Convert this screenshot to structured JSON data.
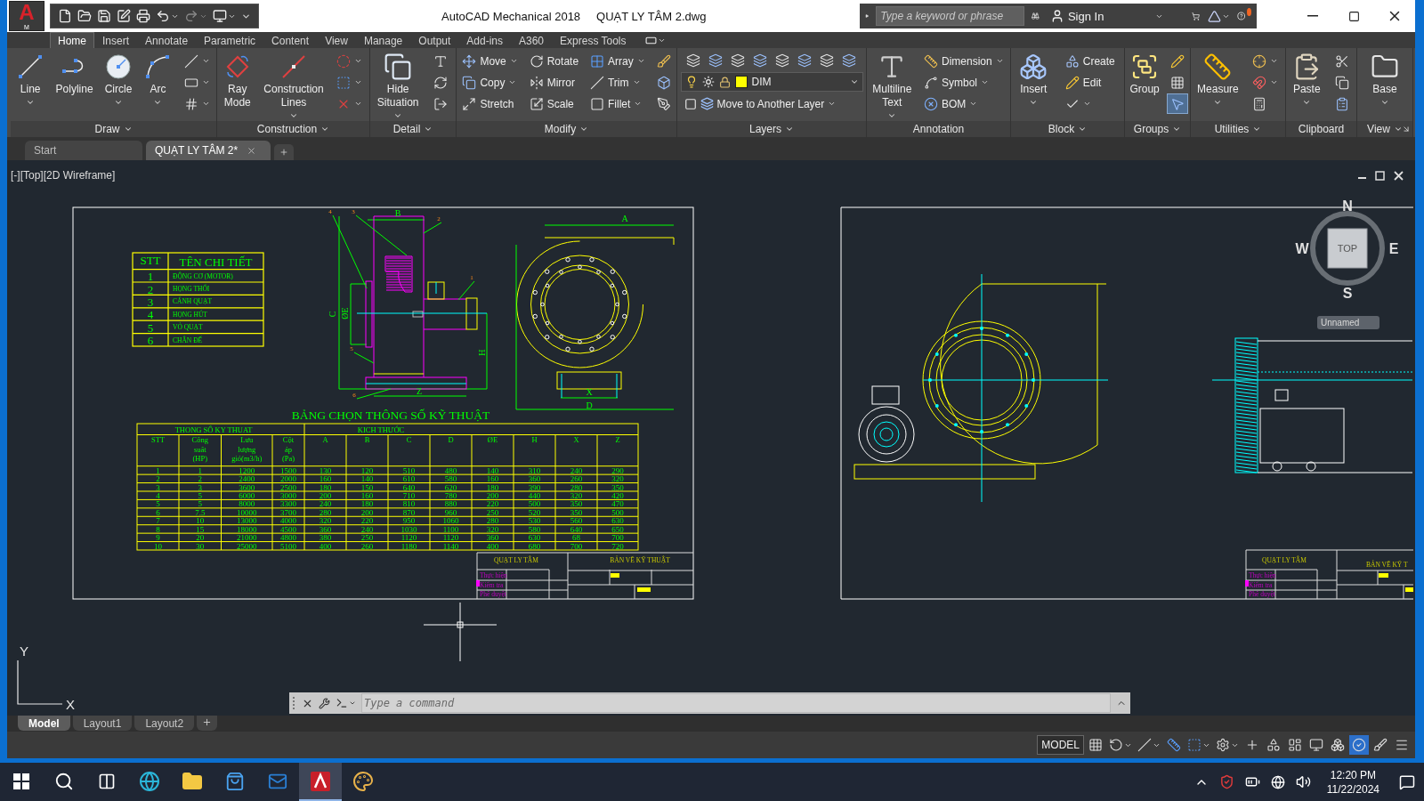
{
  "window": {
    "app_letter": "A",
    "app_badge": "M",
    "product": "AutoCAD Mechanical 2018",
    "document": "QUẠT LY TÂM 2.dwg"
  },
  "search": {
    "placeholder": "Type a keyword or phrase"
  },
  "account": {
    "sign_in": "Sign In"
  },
  "ribbon_tabs": [
    {
      "label": "Home",
      "selected": true
    },
    {
      "label": "Insert",
      "selected": false
    },
    {
      "label": "Annotate",
      "selected": false
    },
    {
      "label": "Parametric",
      "selected": false
    },
    {
      "label": "Content",
      "selected": false
    },
    {
      "label": "View",
      "selected": false
    },
    {
      "label": "Manage",
      "selected": false
    },
    {
      "label": "Output",
      "selected": false
    },
    {
      "label": "Add-ins",
      "selected": false
    },
    {
      "label": "A360",
      "selected": false
    },
    {
      "label": "Express Tools",
      "selected": false
    }
  ],
  "panels": [
    {
      "title": "Draw",
      "dropdown": true,
      "launcher": false,
      "columns": [
        {
          "kind": "large",
          "label": "Line",
          "dropdown": true
        },
        {
          "kind": "large",
          "label": "Polyline",
          "dropdown": false
        },
        {
          "kind": "large",
          "label": "Circle",
          "dropdown": true
        },
        {
          "kind": "large",
          "label": "Arc",
          "dropdown": true
        },
        {
          "kind": "stack",
          "items": [
            {
              "dropdown": true
            },
            {
              "dropdown": true
            },
            {
              "dropdown": true
            }
          ]
        }
      ]
    },
    {
      "title": "Construction",
      "dropdown": true,
      "launcher": false,
      "columns": [
        {
          "kind": "large",
          "label": "Ray Mode",
          "dropdown": false
        },
        {
          "kind": "large",
          "label": "Construction Lines",
          "dropdown": true
        },
        {
          "kind": "stack",
          "items": [
            {
              "dropdown": true
            },
            {
              "dropdown": true
            },
            {
              "dropdown": true
            }
          ]
        }
      ]
    },
    {
      "title": "Detail",
      "dropdown": true,
      "launcher": false,
      "columns": [
        {
          "kind": "large",
          "label": "Hide Situation",
          "dropdown": true
        },
        {
          "kind": "stack",
          "items": [
            {
              "dropdown": false
            },
            {
              "dropdown": false
            },
            {
              "dropdown": false
            }
          ]
        }
      ]
    },
    {
      "title": "Modify",
      "dropdown": true,
      "launcher": false,
      "columns": [
        {
          "kind": "stack",
          "items": [
            {
              "label": "Move",
              "dropdown": true
            },
            {
              "label": "Copy",
              "dropdown": true
            },
            {
              "label": "Stretch",
              "dropdown": false
            }
          ]
        },
        {
          "kind": "stack",
          "items": [
            {
              "label": "Rotate",
              "dropdown": false
            },
            {
              "label": "Mirror",
              "dropdown": false
            },
            {
              "label": "Scale",
              "dropdown": false
            }
          ]
        },
        {
          "kind": "stack",
          "items": [
            {
              "label": "Array",
              "dropdown": true
            },
            {
              "label": "Trim",
              "dropdown": true
            },
            {
              "label": "Fillet",
              "dropdown": true
            }
          ]
        },
        {
          "kind": "stack",
          "items": [
            {
              "dropdown": false
            },
            {
              "dropdown": false
            },
            {
              "dropdown": false
            }
          ]
        }
      ]
    },
    {
      "title": "Layers",
      "dropdown": true,
      "launcher": false,
      "columns": [
        {
          "kind": "layers",
          "layer": {
            "name": "DIM",
            "color": "#ffff00"
          },
          "action": {
            "label": "Move to Another Layer",
            "dropdown": true
          }
        }
      ]
    },
    {
      "title": "Annotation",
      "dropdown": false,
      "launcher": false,
      "columns": [
        {
          "kind": "large",
          "label": "Multiline Text",
          "dropdown": true
        },
        {
          "kind": "stack",
          "items": [
            {
              "label": "Dimension",
              "dropdown": true
            },
            {
              "label": "Symbol",
              "dropdown": true
            },
            {
              "label": "BOM",
              "dropdown": true
            }
          ]
        }
      ]
    },
    {
      "title": "Block",
      "dropdown": true,
      "launcher": false,
      "columns": [
        {
          "kind": "large",
          "label": "Insert",
          "dropdown": true
        },
        {
          "kind": "stack",
          "items": [
            {
              "label": "Create",
              "dropdown": false
            },
            {
              "label": "Edit",
              "dropdown": false
            },
            {
              "dropdown": true
            }
          ]
        }
      ]
    },
    {
      "title": "Groups",
      "dropdown": true,
      "launcher": false,
      "columns": [
        {
          "kind": "large",
          "label": "Group",
          "dropdown": false
        },
        {
          "kind": "stack",
          "items": [
            {
              "dropdown": false,
              "on": false
            },
            {
              "dropdown": false,
              "on": false
            },
            {
              "dropdown": false,
              "on": true
            }
          ]
        }
      ]
    },
    {
      "title": "Utilities",
      "dropdown": true,
      "launcher": false,
      "columns": [
        {
          "kind": "large",
          "label": "Measure",
          "dropdown": true
        },
        {
          "kind": "stack",
          "items": [
            {
              "dropdown": true
            },
            {
              "dropdown": true
            },
            {
              "dropdown": false
            }
          ]
        }
      ]
    },
    {
      "title": "Clipboard",
      "dropdown": false,
      "launcher": false,
      "columns": [
        {
          "kind": "large",
          "label": "Paste",
          "dropdown": true
        },
        {
          "kind": "stack",
          "items": [
            {
              "dropdown": false
            },
            {
              "dropdown": false
            },
            {
              "dropdown": false
            }
          ]
        }
      ]
    },
    {
      "title": "View",
      "dropdown": true,
      "launcher": true,
      "columns": [
        {
          "kind": "large",
          "label": "Base",
          "dropdown": true
        }
      ]
    }
  ],
  "file_tabs": [
    {
      "label": "Start",
      "selected": false
    },
    {
      "label": "QUẠT LY TÂM 2*",
      "selected": true
    }
  ],
  "viewport": {
    "label": "[-][Top][2D Wireframe]",
    "viewcube": {
      "top": "TOP",
      "north": "N",
      "south": "S",
      "east": "E",
      "west": "W",
      "ucs_menu": "Unnamed"
    },
    "ucs": {
      "x": "X",
      "y": "Y"
    },
    "drawing": {
      "parts_table": {
        "headers": [
          "STT",
          "TÊN CHI TIẾT"
        ],
        "rows": [
          {
            "no": "1",
            "name": "ĐỘNG CƠ (MOTOR)"
          },
          {
            "no": "2",
            "name": "HỌNG THỔI"
          },
          {
            "no": "3",
            "name": "CÁNH QUẠT"
          },
          {
            "no": "4",
            "name": "HỌNG HÚT"
          },
          {
            "no": "5",
            "name": "VỎ QUẠT"
          },
          {
            "no": "6",
            "name": "CHÂN ĐẾ"
          }
        ]
      },
      "front_view": {
        "dims": [
          "B",
          "C",
          "ØE",
          "H",
          "Z"
        ],
        "callouts": [
          "1",
          "2",
          "3",
          "4",
          "5",
          "6"
        ]
      },
      "side_view": {
        "dims": [
          "A",
          "X",
          "D"
        ]
      },
      "spec_table": {
        "title": "BẢNG CHỌN THÔNG SỐ KỸ THUẬT",
        "groups": [
          "THONG SỐ KY THUAT",
          "KICH THƯỚC"
        ],
        "columns": [
          "STT",
          "Công suất (HP)",
          "Lưu lượng gió(m3/h)",
          "Cột áp (Pa)",
          "A",
          "B",
          "C",
          "D",
          "ØE",
          "H",
          "X",
          "Z"
        ],
        "rows": [
          [
            "1",
            "1",
            "1200",
            "1500",
            "130",
            "120",
            "510",
            "480",
            "140",
            "310",
            "240",
            "290"
          ],
          [
            "2",
            "2",
            "2400",
            "2000",
            "160",
            "140",
            "610",
            "580",
            "160",
            "360",
            "260",
            "320"
          ],
          [
            "3",
            "3",
            "3600",
            "2500",
            "180",
            "150",
            "640",
            "620",
            "180",
            "390",
            "280",
            "350"
          ],
          [
            "4",
            "5",
            "6000",
            "3000",
            "200",
            "160",
            "710",
            "780",
            "200",
            "440",
            "320",
            "420"
          ],
          [
            "5",
            "5",
            "8000",
            "3300",
            "240",
            "180",
            "810",
            "880",
            "220",
            "500",
            "350",
            "470"
          ],
          [
            "6",
            "7.5",
            "10000",
            "3700",
            "280",
            "200",
            "870",
            "960",
            "250",
            "520",
            "350",
            "500"
          ],
          [
            "7",
            "10",
            "13000",
            "4000",
            "320",
            "220",
            "950",
            "1060",
            "280",
            "530",
            "560",
            "630"
          ],
          [
            "8",
            "15",
            "18000",
            "4500",
            "360",
            "240",
            "1030",
            "1100",
            "320",
            "580",
            "640",
            "650"
          ],
          [
            "9",
            "20",
            "21000",
            "4800",
            "380",
            "250",
            "1120",
            "1120",
            "360",
            "630",
            "68",
            "700"
          ],
          [
            "10",
            "30",
            "25000",
            "5100",
            "400",
            "260",
            "1180",
            "1140",
            "400",
            "680",
            "700",
            "720"
          ]
        ]
      },
      "title_blocks": [
        {
          "name": "QUẠT LY TÂM",
          "drawing_type": "BẢN VẼ KỸ THUẬT",
          "roles": [
            "Thực hiện",
            "Kiểm tra",
            "Phê duyệt"
          ]
        },
        {
          "name": "QUẠT LY TÂM",
          "drawing_type": "BẢN VẼ KỸ T",
          "roles": [
            "Thực hiện",
            "Kiểm tra",
            "Phê duyệt"
          ]
        }
      ]
    }
  },
  "command_line": {
    "placeholder": "Type a command"
  },
  "layout_tabs": [
    {
      "label": "Model",
      "selected": true
    },
    {
      "label": "Layout1",
      "selected": false
    },
    {
      "label": "Layout2",
      "selected": false
    }
  ],
  "status_bar": {
    "mode": "MODEL"
  },
  "taskbar": {
    "apps": [
      {
        "active": false
      },
      {
        "active": false
      },
      {
        "active": false
      },
      {
        "active": false
      },
      {
        "active": false
      },
      {
        "active": false
      },
      {
        "active": false
      },
      {
        "active": true
      },
      {
        "active": false
      }
    ],
    "time": "12:20 PM",
    "date": "11/22/2024"
  }
}
